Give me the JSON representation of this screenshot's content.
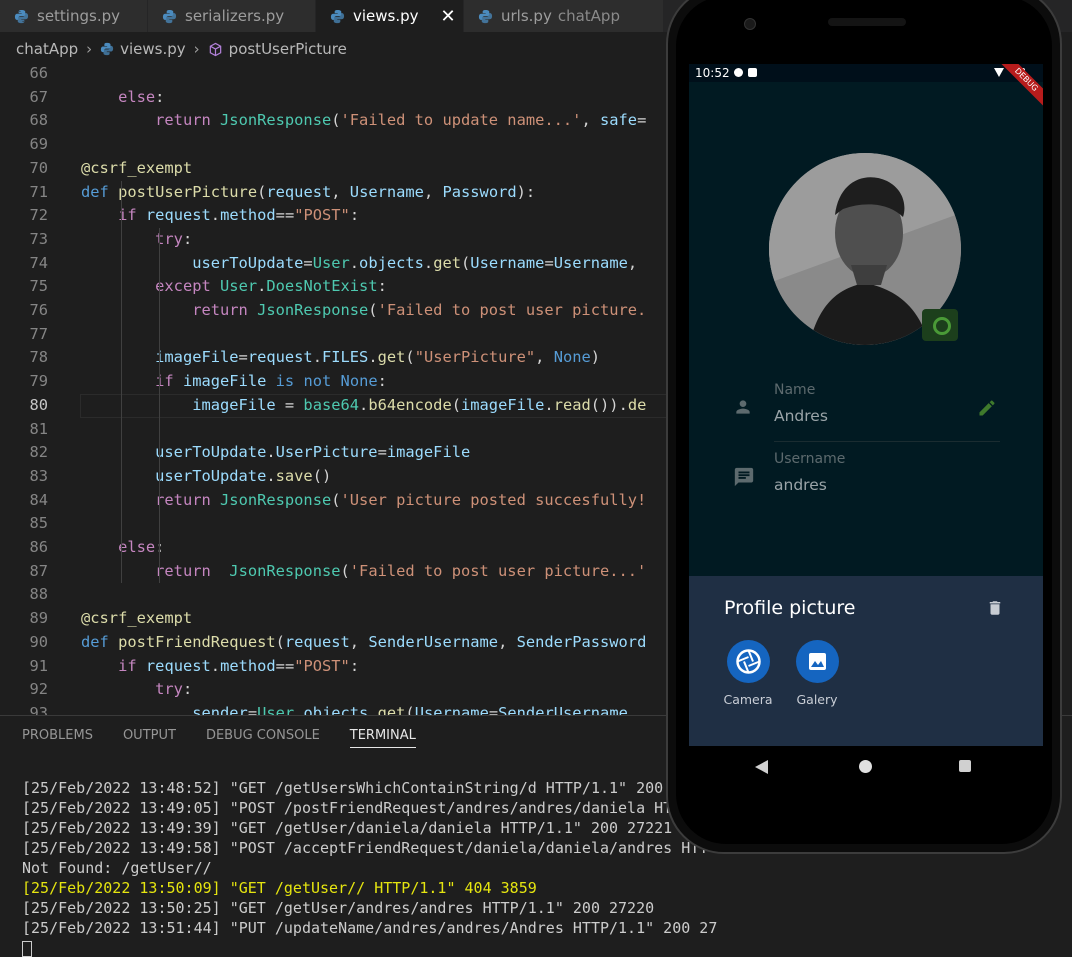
{
  "colors": {
    "accent_blue": "#1565c0",
    "edit_green": "#4a9a37",
    "debug_ribbon": "#b71c1c"
  },
  "tabs": [
    {
      "label": "settings.py",
      "sub": ""
    },
    {
      "label": "serializers.py",
      "sub": ""
    },
    {
      "label": "views.py",
      "sub": "",
      "active": true
    },
    {
      "label": "urls.py",
      "sub": "chatApp"
    }
  ],
  "breadcrumb": {
    "folder": "chatApp",
    "file": "views.py",
    "symbol": "postUserPicture"
  },
  "code": {
    "current_line": "80",
    "lines": [
      {
        "n": "66",
        "html": ""
      },
      {
        "n": "67",
        "html": "    <span class='kw'>else</span>:"
      },
      {
        "n": "68",
        "html": "        <span class='kw'>return</span> <span class='cls'>JsonResponse</span>(<span class='str'>'Failed to update name...'</span>, <span class='par'>safe</span>="
      },
      {
        "n": "69",
        "html": ""
      },
      {
        "n": "70",
        "html": "<span class='fn'>@csrf_exempt</span>"
      },
      {
        "n": "71",
        "html": "<span class='def'>def</span> <span class='fn'>postUserPicture</span>(<span class='par'>request</span>, <span class='par'>Username</span>, <span class='par'>Password</span>):"
      },
      {
        "n": "72",
        "html": "    <span class='kw'>if</span> <span class='par'>request</span>.<span class='par'>method</span>==<span class='str'>\"POST\"</span>:"
      },
      {
        "n": "73",
        "html": "        <span class='kw'>try</span>:"
      },
      {
        "n": "74",
        "html": "            <span class='par'>userToUpdate</span>=<span class='cls'>User</span>.<span class='par'>objects</span>.<span class='fn'>get</span>(<span class='par'>Username</span>=<span class='par'>Username</span>,"
      },
      {
        "n": "75",
        "html": "        <span class='kw'>except</span> <span class='cls'>User</span>.<span class='cls'>DoesNotExist</span>:"
      },
      {
        "n": "76",
        "html": "            <span class='kw'>return</span> <span class='cls'>JsonResponse</span>(<span class='str'>'Failed to post user picture.</span>"
      },
      {
        "n": "77",
        "html": ""
      },
      {
        "n": "78",
        "html": "        <span class='par'>imageFile</span>=<span class='par'>request</span>.<span class='par'>FILES</span>.<span class='fn'>get</span>(<span class='str'>\"UserPicture\"</span>, <span class='con'>None</span>)"
      },
      {
        "n": "79",
        "html": "        <span class='kw'>if</span> <span class='par'>imageFile</span> <span class='def'>is not</span> <span class='con'>None</span>:"
      },
      {
        "n": "80",
        "html": "            <span class='par'>imageFile</span> = <span class='cls'>base64</span>.<span class='fn'>b64encode</span>(<span class='par'>imageFile</span>.<span class='fn'>read</span>()).<span class='fn'>de</span>"
      },
      {
        "n": "81",
        "html": ""
      },
      {
        "n": "82",
        "html": "        <span class='par'>userToUpdate</span>.<span class='par'>UserPicture</span>=<span class='par'>imageFile</span>"
      },
      {
        "n": "83",
        "html": "        <span class='par'>userToUpdate</span>.<span class='fn'>save</span>()"
      },
      {
        "n": "84",
        "html": "        <span class='kw'>return</span> <span class='cls'>JsonResponse</span>(<span class='str'>'User picture posted succesfully!</span>"
      },
      {
        "n": "85",
        "html": ""
      },
      {
        "n": "86",
        "html": "    <span class='kw'>else</span>:"
      },
      {
        "n": "87",
        "html": "        <span class='kw'>return</span>  <span class='cls'>JsonResponse</span>(<span class='str'>'Failed to post user picture...'</span>"
      },
      {
        "n": "88",
        "html": ""
      },
      {
        "n": "89",
        "html": "<span class='fn'>@csrf_exempt</span>"
      },
      {
        "n": "90",
        "html": "<span class='def'>def</span> <span class='fn'>postFriendRequest</span>(<span class='par'>request</span>, <span class='par'>SenderUsername</span>, <span class='par'>SenderPassword</span>"
      },
      {
        "n": "91",
        "html": "    <span class='kw'>if</span> <span class='par'>request</span>.<span class='par'>method</span>==<span class='str'>\"POST\"</span>:"
      },
      {
        "n": "92",
        "html": "        <span class='kw'>try</span>:"
      },
      {
        "n": "93",
        "html": "            <span class='par'>sender</span>=<span class='cls'>User</span>.<span class='par'>objects</span>.<span class='fn'>get</span>(<span class='par'>Username</span>=<span class='par'>SenderUsername</span>,"
      }
    ]
  },
  "panel": {
    "tabs": [
      "PROBLEMS",
      "OUTPUT",
      "DEBUG CONSOLE",
      "TERMINAL"
    ],
    "active_tab": "TERMINAL",
    "terminal_lines": [
      {
        "text": "[25/Feb/2022 13:48:52] \"GET /getUsersWhichContainString/d HTTP/1.1\" 200",
        "hi": false
      },
      {
        "text": "[25/Feb/2022 13:49:05] \"POST /postFriendRequest/andres/andres/daniela HT",
        "hi": false
      },
      {
        "text": "[25/Feb/2022 13:49:39] \"GET /getUser/daniela/daniela HTTP/1.1\" 200 27221",
        "hi": false
      },
      {
        "text": "[25/Feb/2022 13:49:58] \"POST /acceptFriendRequest/daniela/daniela/andres HTT",
        "hi": false
      },
      {
        "text": "Not Found: /getUser//",
        "hi": false
      },
      {
        "text": "[25/Feb/2022 13:50:09] \"GET /getUser// HTTP/1.1\" 404 3859",
        "hi": true
      },
      {
        "text": "[25/Feb/2022 13:50:25] \"GET /getUser/andres/andres HTTP/1.1\" 200 27220",
        "hi": false
      },
      {
        "text": "[25/Feb/2022 13:51:44] \"PUT /updateName/andres/andres/Andres HTTP/1.1\" 200 27",
        "hi": false
      }
    ]
  },
  "phone": {
    "time": "10:52",
    "debug_label": "DEBUG",
    "name_label": "Name",
    "name_value": "Andres",
    "username_label": "Username",
    "username_value": "andres",
    "sheet_title": "Profile picture",
    "camera_label": "Camera",
    "gallery_label": "Galery"
  }
}
